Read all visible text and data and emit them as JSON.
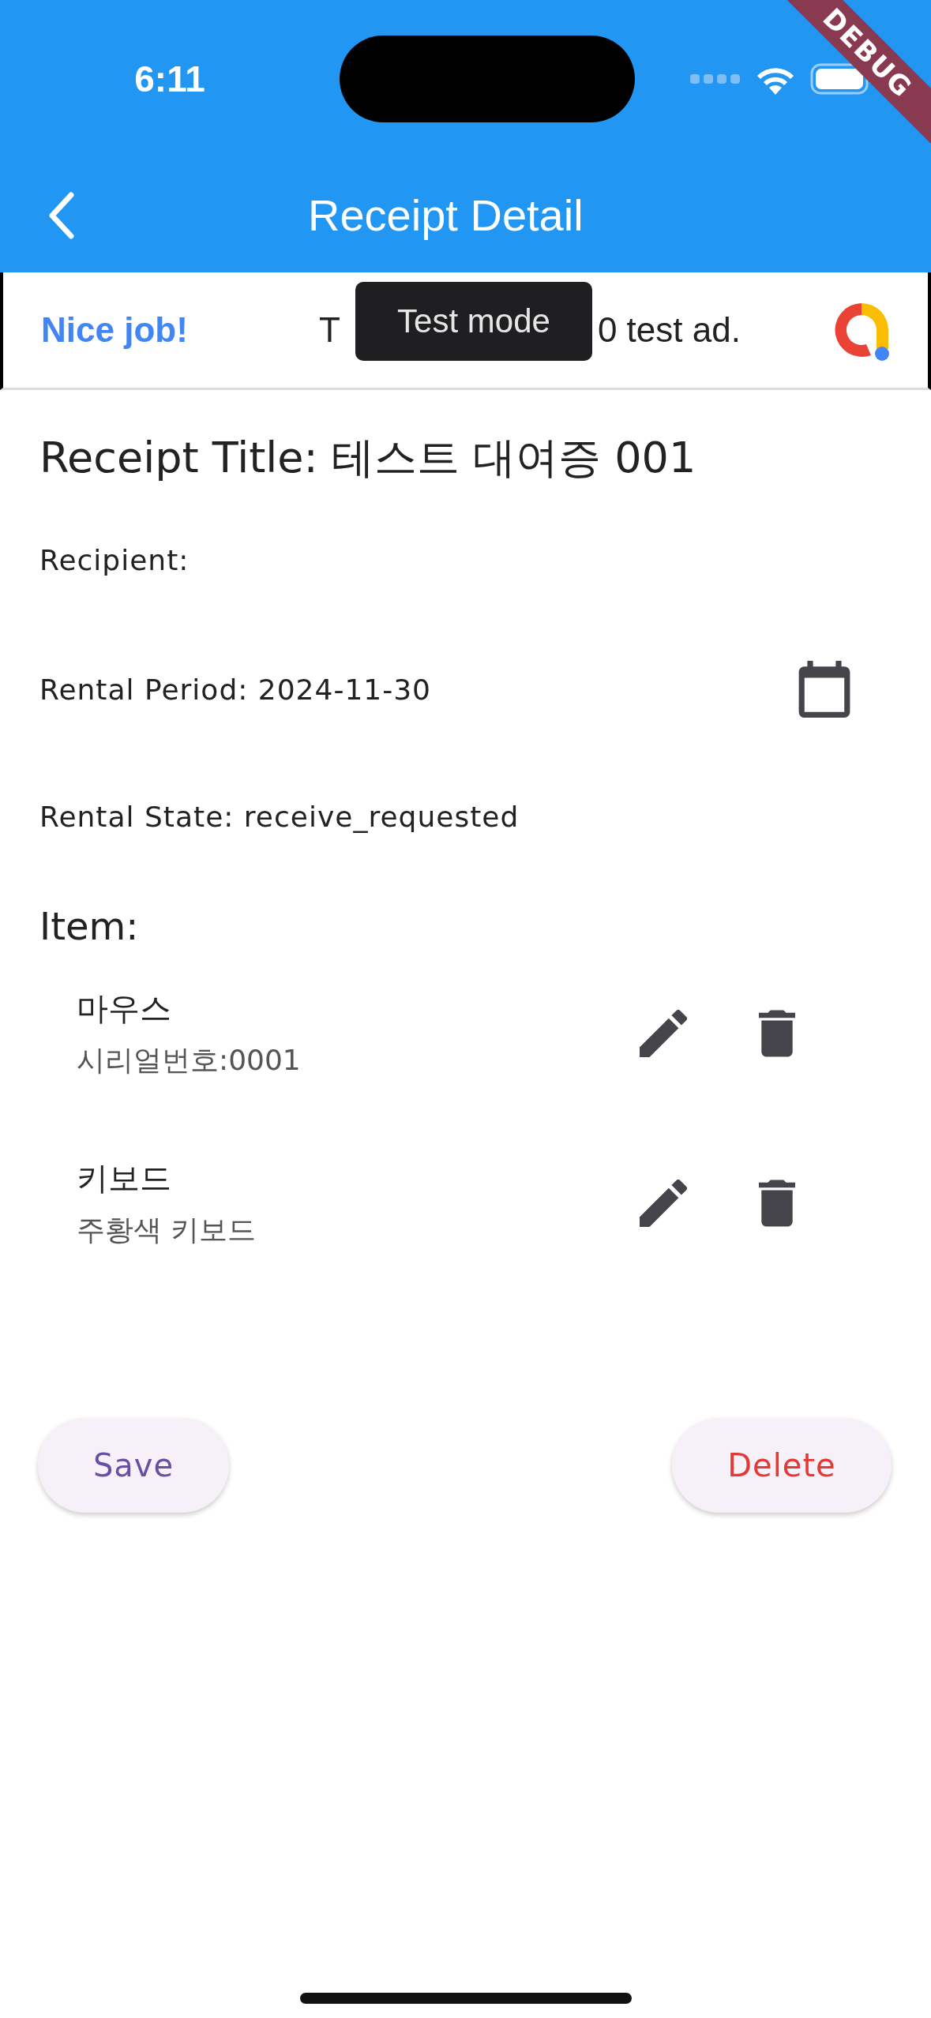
{
  "status_bar": {
    "time": "6:11"
  },
  "debug_banner": "DEBUG",
  "app_bar": {
    "title": "Receipt Detail"
  },
  "ad_banner": {
    "headline": "Nice job!",
    "text_start": "T",
    "text_end": "0 test ad.",
    "tooltip": "Test mode"
  },
  "receipt": {
    "title": "Receipt Title: 테스트 대여증 001",
    "recipient": "Recipient:",
    "rental_period": "Rental Period: 2024-11-30",
    "rental_state": "Rental State: receive_requested"
  },
  "items_heading": "Item:",
  "items": [
    {
      "name": "마우스",
      "detail": "시리얼번호:0001"
    },
    {
      "name": "키보드",
      "detail": "주황색 키보드"
    }
  ],
  "buttons": [
    {
      "label": "Save",
      "kind": "save"
    },
    {
      "label": "Delete",
      "kind": "delete"
    }
  ]
}
